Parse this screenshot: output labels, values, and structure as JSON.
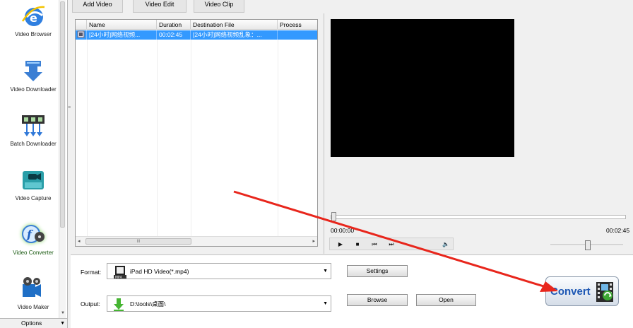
{
  "sidebar": {
    "items": [
      {
        "label": "Video Browser",
        "icon": "ie-globe-icon"
      },
      {
        "label": "Video Downloader",
        "icon": "download-arrow-icon"
      },
      {
        "label": "Batch Downloader",
        "icon": "film-strip-download-icon"
      },
      {
        "label": "Video Capture",
        "icon": "video-camera-icon"
      },
      {
        "label": "Video Converter",
        "icon": "convert-reel-icon",
        "active": true
      },
      {
        "label": "Video Maker",
        "icon": "film-reel-icon"
      }
    ],
    "options_label": "Options"
  },
  "tabs": [
    "Add Video",
    "Video Edit",
    "Video Clip"
  ],
  "file_list": {
    "columns": [
      "Name",
      "Duration",
      "Destination File",
      "Process"
    ],
    "rows": [
      {
        "name": "[24小时]网络视频...",
        "duration": "00:02:45",
        "destination": "[24小时]网络视频乱象：...",
        "process": ""
      }
    ],
    "scroll_thumb_label": "III"
  },
  "player": {
    "current_time": "00:00:00",
    "total_time": "00:02:45",
    "seek_position": 0,
    "volume_level": 0.5,
    "controls": {
      "play": "▶",
      "stop": "■",
      "prev": "⏮",
      "next": "⏭",
      "mute": "🔈"
    }
  },
  "settings": {
    "format_label": "Format:",
    "format_value": "iPad HD Video(*.mp4)",
    "output_label": "Output:",
    "output_value": "D:\\tools\\桌面\\",
    "settings_button": "Settings",
    "browse_button": "Browse",
    "open_button": "Open",
    "convert_button": "Convert"
  },
  "colors": {
    "selection": "#3399ff",
    "annotation_arrow": "#e8261c",
    "convert_text": "#1c56b3"
  }
}
